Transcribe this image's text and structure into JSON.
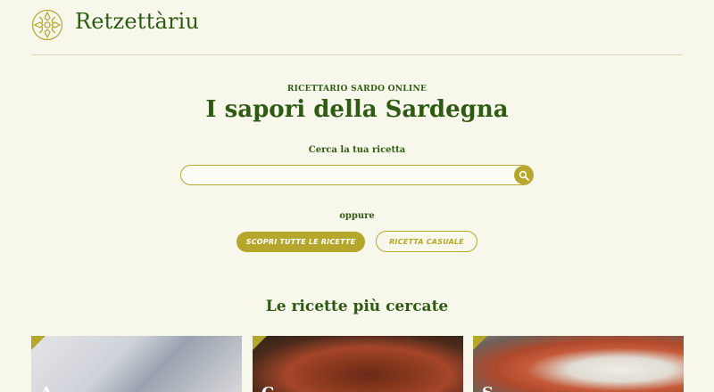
{
  "brand": {
    "name": "Retzettàriu"
  },
  "hero": {
    "eyebrow": "RICETTARIO SARDO ONLINE",
    "title": "I sapori della Sardegna",
    "search_label": "Cerca la tua ricetta",
    "search_value": "",
    "or_label": "oppure",
    "primary_button": "SCOPRI TUTTE LE RICETTE",
    "secondary_button": "RICETTA CASUALE"
  },
  "popular": {
    "title": "Le ricette più cercate",
    "cards": [
      {
        "caption": "A..."
      },
      {
        "caption": "C..."
      },
      {
        "caption": "S..."
      }
    ]
  },
  "colors": {
    "brand_green": "#2e5b12",
    "accent_gold": "#b5a62c",
    "background": "#f8f7ec"
  },
  "icons": {
    "logo": "sardinian-knot-logo-icon",
    "search": "search-icon"
  }
}
